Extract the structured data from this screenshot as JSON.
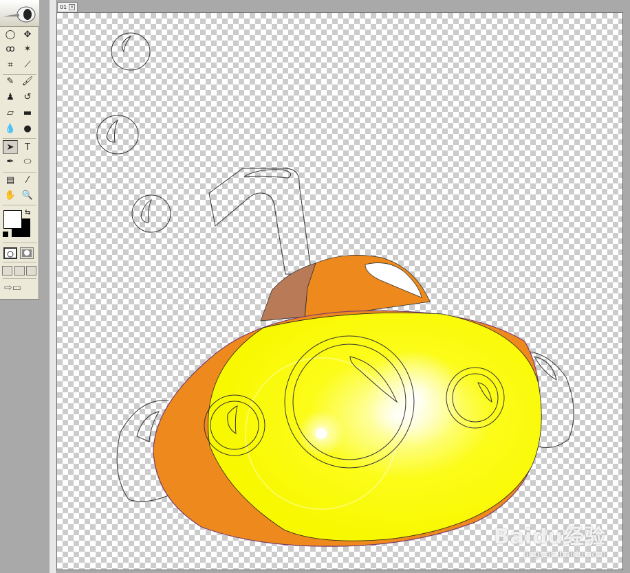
{
  "toolbox": {
    "tools": [
      {
        "name": "elliptical-marquee-tool-icon",
        "glyph": "◯"
      },
      {
        "name": "move-tool-icon",
        "glyph": "✥"
      },
      {
        "name": "lasso-tool-icon",
        "glyph": "ꝏ"
      },
      {
        "name": "magic-wand-tool-icon",
        "glyph": "✶"
      },
      {
        "name": "crop-tool-icon",
        "glyph": "⌗"
      },
      {
        "name": "slice-tool-icon",
        "glyph": "⟋"
      },
      {
        "name": "healing-brush-tool-icon",
        "glyph": "✎"
      },
      {
        "name": "brush-tool-icon",
        "glyph": "🖌"
      },
      {
        "name": "clone-stamp-tool-icon",
        "glyph": "♟"
      },
      {
        "name": "history-brush-tool-icon",
        "glyph": "↺"
      },
      {
        "name": "eraser-tool-icon",
        "glyph": "▱"
      },
      {
        "name": "gradient-tool-icon",
        "glyph": "▬"
      },
      {
        "name": "blur-tool-icon",
        "glyph": "💧"
      },
      {
        "name": "dodge-tool-icon",
        "glyph": "●"
      },
      {
        "name": "path-selection-tool-icon",
        "glyph": "➤"
      },
      {
        "name": "type-tool-icon",
        "glyph": "T"
      },
      {
        "name": "pen-tool-icon",
        "glyph": "✒"
      },
      {
        "name": "ellipse-shape-tool-icon",
        "glyph": "⬭"
      },
      {
        "name": "notes-tool-icon",
        "glyph": "▤"
      },
      {
        "name": "eyedropper-tool-icon",
        "glyph": "⁄"
      },
      {
        "name": "hand-tool-icon",
        "glyph": "✋"
      },
      {
        "name": "zoom-tool-icon",
        "glyph": "🔍"
      }
    ],
    "foreground_color": "#ffffff",
    "background_color": "#000000"
  },
  "document": {
    "tab_label": "01"
  },
  "artwork": {
    "colors": {
      "hull_yellow": "#fcfc00",
      "hull_orange": "#ee8a1d",
      "tower_brown": "#b97a57",
      "outline": "#333333"
    }
  },
  "watermark": {
    "main": "Baidu经验",
    "sub": "jingyan.baidu.com"
  }
}
